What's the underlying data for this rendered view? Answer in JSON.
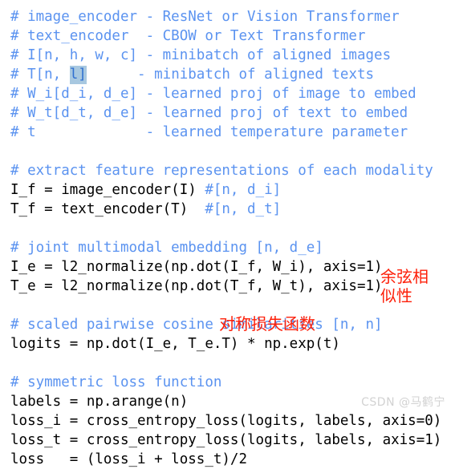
{
  "document": {
    "kind": "code-snippet-screenshot",
    "background_color": "#ffffff",
    "comment_color": "#5b93f0",
    "code_color": "#000000",
    "annotation_color": "#fd1f09",
    "selection_background": "#a8c8e0",
    "watermark_color": "#d2d2d2"
  },
  "code": {
    "lines": [
      {
        "type": "comment",
        "text": "# image_encoder - ResNet or Vision Transformer"
      },
      {
        "type": "comment",
        "text": "# text_encoder  - CBOW or Text Transformer"
      },
      {
        "type": "comment",
        "text": "# I[n, h, w, c] - minibatch of aligned images"
      },
      {
        "type": "comment-selection",
        "prefix": "# T[n, ",
        "selected": "l]",
        "suffix": "      - minibatch of aligned texts"
      },
      {
        "type": "comment",
        "text": "# W_i[d_i, d_e] - learned proj of image to embed"
      },
      {
        "type": "comment",
        "text": "# W_t[d_t, d_e] - learned proj of text to embed"
      },
      {
        "type": "comment",
        "text": "# t             - learned temperature parameter"
      },
      {
        "type": "blank",
        "text": ""
      },
      {
        "type": "comment",
        "text": "# extract feature representations of each modality"
      },
      {
        "type": "mixed",
        "code": "I_f = image_encoder(I) ",
        "comment": "#[n, d_i]"
      },
      {
        "type": "mixed",
        "code": "T_f = text_encoder(T)  ",
        "comment": "#[n, d_t]"
      },
      {
        "type": "blank",
        "text": ""
      },
      {
        "type": "comment",
        "text": "# joint multimodal embedding [n, d_e]"
      },
      {
        "type": "code",
        "text": "I_e = l2_normalize(np.dot(I_f, W_i), axis=1)"
      },
      {
        "type": "code",
        "text": "T_e = l2_normalize(np.dot(T_f, W_t), axis=1)"
      },
      {
        "type": "blank",
        "text": ""
      },
      {
        "type": "comment",
        "text": "# scaled pairwise cosine similarities [n, n]"
      },
      {
        "type": "code",
        "text": "logits = np.dot(I_e, T_e.T) * np.exp(t)"
      },
      {
        "type": "blank",
        "text": ""
      },
      {
        "type": "comment",
        "text": "# symmetric loss function"
      },
      {
        "type": "code",
        "text": "labels = np.arange(n)"
      },
      {
        "type": "code",
        "text": "loss_i = cross_entropy_loss(logits, labels, axis=0)"
      },
      {
        "type": "code",
        "text": "loss_t = cross_entropy_loss(logits, labels, axis=1)"
      },
      {
        "type": "code",
        "text": "loss   = (loss_i + loss_t)/2"
      }
    ]
  },
  "annotations": {
    "cosine_similarity": "余弦相\n似性",
    "symmetric_loss": "对称损失函数"
  },
  "watermark": {
    "text": "CSDN @马鹤宁"
  }
}
